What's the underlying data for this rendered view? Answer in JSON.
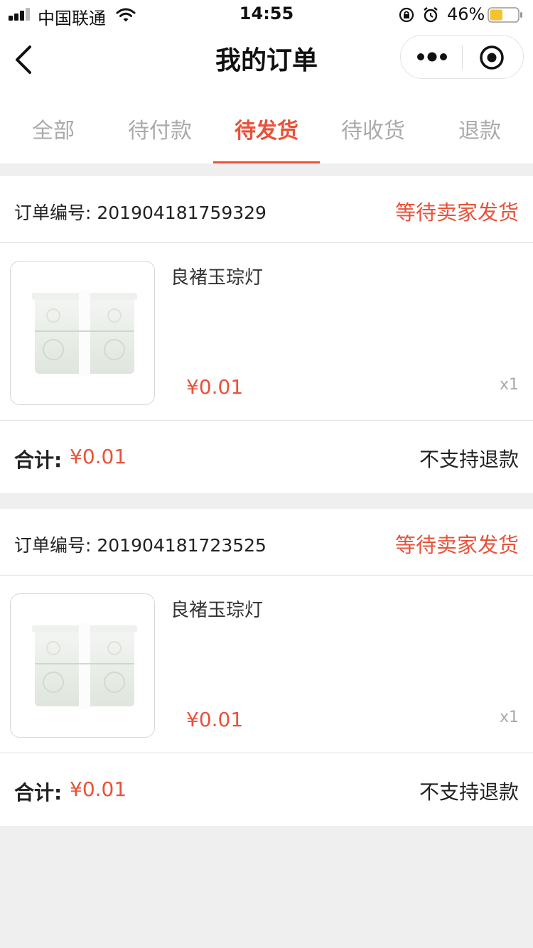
{
  "status_bar": {
    "carrier": "中国联通",
    "time": "14:55",
    "battery_percent": "46%",
    "battery_level": 0.46,
    "battery_color": "#f5c230"
  },
  "nav": {
    "title": "我的订单",
    "back_icon": "chevron-left-icon",
    "more_icon": "more-dots-icon",
    "close_icon": "target-close-icon"
  },
  "tabs": [
    {
      "label": "全部",
      "active": false
    },
    {
      "label": "待付款",
      "active": false
    },
    {
      "label": "待发货",
      "active": true
    },
    {
      "label": "待收货",
      "active": false
    },
    {
      "label": "退款",
      "active": false
    }
  ],
  "accent_color": "#e8523a",
  "orders": [
    {
      "order_no_label": "订单编号: 201904181759329",
      "status": "等待卖家发货",
      "product_name": "良褚玉琮灯",
      "price": "¥0.01",
      "qty": "x1",
      "total_label": "合计:",
      "total_value": "¥0.01",
      "refund_note": "不支持退款"
    },
    {
      "order_no_label": "订单编号: 201904181723525",
      "status": "等待卖家发货",
      "product_name": "良褚玉琮灯",
      "price": "¥0.01",
      "qty": "x1",
      "total_label": "合计:",
      "total_value": "¥0.01",
      "refund_note": "不支持退款"
    }
  ]
}
